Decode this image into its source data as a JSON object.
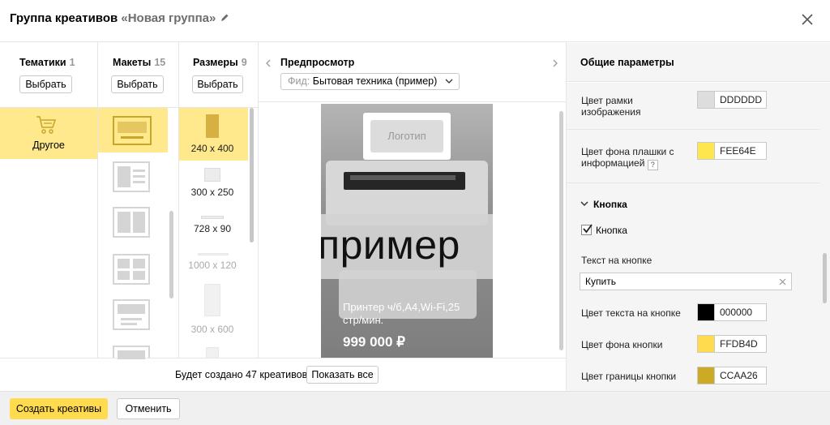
{
  "dialog": {
    "title_prefix": "Группа креативов",
    "group_name": "«Новая группа»",
    "edit_icon": "pencil-icon",
    "close_icon": "close-icon"
  },
  "columns": {
    "topics": {
      "label": "Тематики",
      "count": "1",
      "button": "Выбрать",
      "item_label": "Другое",
      "item_icon": "shopping-cart-icon"
    },
    "layouts": {
      "label": "Макеты",
      "count": "15",
      "button": "Выбрать"
    },
    "sizes": {
      "label": "Размеры",
      "count": "9",
      "button": "Выбрать",
      "items": [
        "240 x 400",
        "300 x 250",
        "728 x 90",
        "1000 x 120",
        "300 x 600"
      ],
      "selected": "240 x 400"
    }
  },
  "preview": {
    "label": "Предпросмотр",
    "feed_prefix": "Фид:",
    "feed_value": "Бытовая техника (пример)",
    "logo_text": "Логотип",
    "watermark": "пример",
    "product_name": "Принтер ч/б,А4,Wi-Fi,25 стр/мин.",
    "price": "999 000 ₽",
    "footer_text": "Будет создано 47 креативов",
    "show_all": "Показать все"
  },
  "params": {
    "title": "Общие параметры",
    "frame_color_label": "Цвет рамки изображения",
    "frame_color": "DDDDDD",
    "plate_bg_label": "Цвет фона плашки с информацией",
    "plate_bg_color": "FEE64E",
    "help_mark": "?",
    "button_section": "Кнопка",
    "button_checkbox_label": "Кнопка",
    "button_checked": true,
    "button_text_label": "Текст на кнопке",
    "button_text_value": "Купить",
    "button_text_color_label": "Цвет текста на кнопке",
    "button_text_color": "000000",
    "button_bg_label": "Цвет фона кнопки",
    "button_bg_color": "FFDB4D",
    "button_border_label": "Цвет границы кнопки",
    "button_border_color": "CCAA26"
  },
  "footer": {
    "create_button": "Создать креативы",
    "cancel_button": "Отменить"
  },
  "colors": {
    "accent_yellow": "#ffdb4d",
    "selection_yellow": "#ffe98c",
    "swatch_dddddd": "#dddddd",
    "swatch_fee64e": "#fee64e",
    "swatch_000000": "#000000",
    "swatch_ffdb4d": "#ffdb4d",
    "swatch_ccaa26": "#ccaa26"
  }
}
